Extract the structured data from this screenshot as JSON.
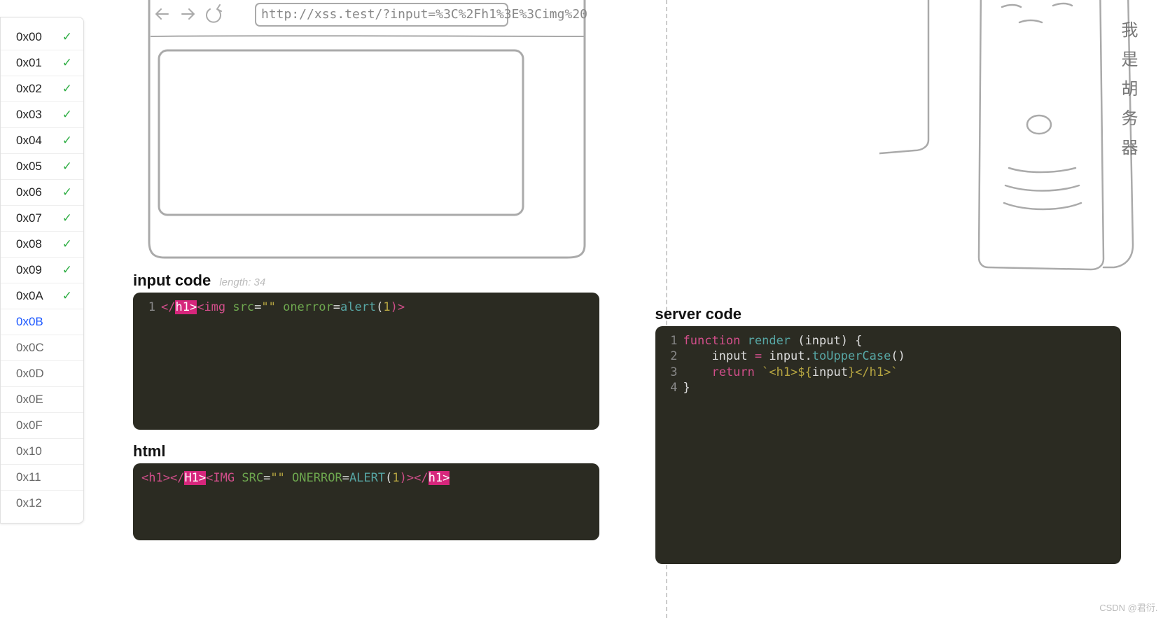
{
  "sidebar": [
    {
      "label": "0x00",
      "done": true,
      "active": false
    },
    {
      "label": "0x01",
      "done": true,
      "active": false
    },
    {
      "label": "0x02",
      "done": true,
      "active": false
    },
    {
      "label": "0x03",
      "done": true,
      "active": false
    },
    {
      "label": "0x04",
      "done": true,
      "active": false
    },
    {
      "label": "0x05",
      "done": true,
      "active": false
    },
    {
      "label": "0x06",
      "done": true,
      "active": false
    },
    {
      "label": "0x07",
      "done": true,
      "active": false
    },
    {
      "label": "0x08",
      "done": true,
      "active": false
    },
    {
      "label": "0x09",
      "done": true,
      "active": false
    },
    {
      "label": "0x0A",
      "done": true,
      "active": false
    },
    {
      "label": "0x0B",
      "done": false,
      "active": true
    },
    {
      "label": "0x0C",
      "done": false,
      "active": false
    },
    {
      "label": "0x0D",
      "done": false,
      "active": false
    },
    {
      "label": "0x0E",
      "done": false,
      "active": false
    },
    {
      "label": "0x0F",
      "done": false,
      "active": false
    },
    {
      "label": "0x10",
      "done": false,
      "active": false
    },
    {
      "label": "0x11",
      "done": false,
      "active": false
    },
    {
      "label": "0x12",
      "done": false,
      "active": false
    }
  ],
  "url": "http://xss.test/?input=%3C%2Fh1%3E%3Cimg%20",
  "inputTitle": "input code",
  "lengthLabel": "length: 34",
  "htmlTitle": "html",
  "serverTitle": "server code",
  "inputCode": {
    "ln": "1",
    "t1": "</",
    "t2": "h1>",
    "t3": "<img ",
    "t4": "src",
    "t5": "=",
    "t6": "\"\"",
    "t7": " onerror",
    "t8": "=",
    "t9": "alert",
    "t10": "(",
    "t11": "1",
    "t12": ")>"
  },
  "htmlCode": {
    "t1": "<h1>",
    "t2": "</",
    "t3": "H1>",
    "t4": "<IMG ",
    "t5": "SRC",
    "t6": "=",
    "t7": "\"\"",
    "t8": " ONERROR",
    "t9": "=",
    "t10": "ALERT",
    "t11": "(",
    "t12": "1",
    "t13": ")>",
    "t14": "</",
    "t15": "h1>"
  },
  "serverCode": {
    "l1": {
      "ln": "1",
      "a": "function ",
      "b": "render ",
      "c": "(",
      "d": "input",
      "e": ") {"
    },
    "l2": {
      "ln": "2",
      "a": "    input ",
      "b": "=",
      "c": " input",
      "d": ".",
      "e": "toUpperCase",
      "f": "()"
    },
    "l3": {
      "ln": "3",
      "a": "    ",
      "b": "return ",
      "c": "`<h1>${",
      "d": "input",
      "e": "}</h1>`"
    },
    "l4": {
      "ln": "4",
      "a": "}"
    }
  },
  "serverLabel": "我是胡务器",
  "watermark": "CSDN @君衍.⠀"
}
